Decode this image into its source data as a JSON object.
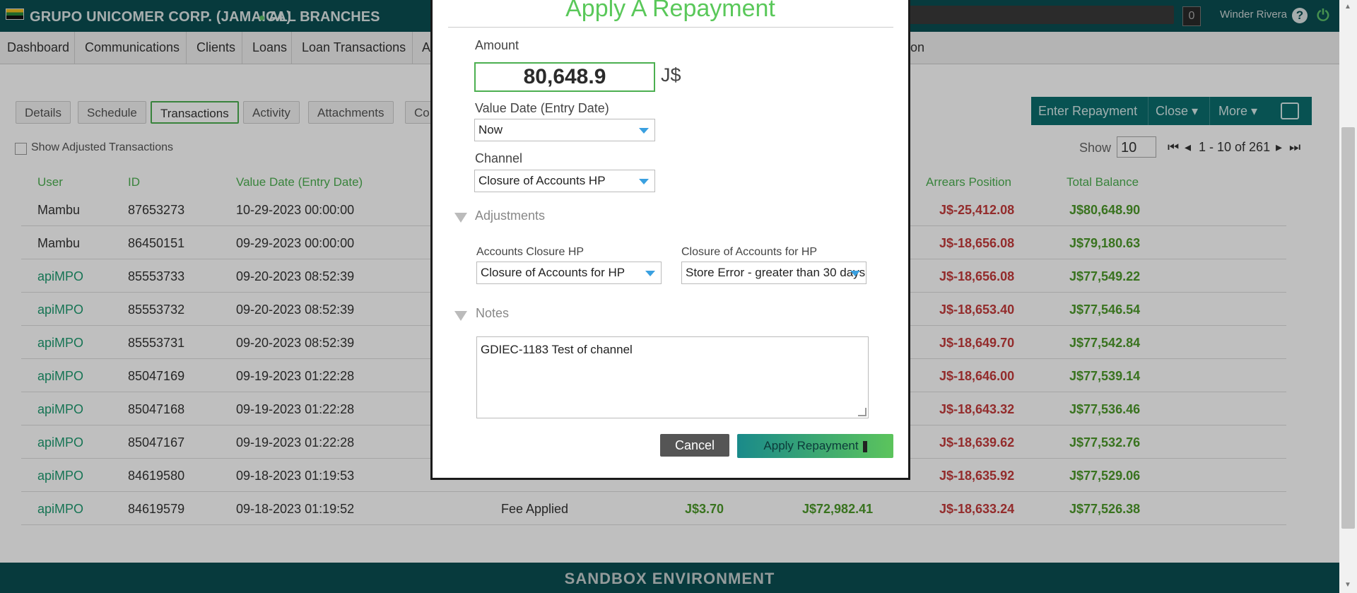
{
  "header": {
    "org_name": "GRUPO UNICOMER CORP. (JAMAICA)",
    "branch": "ALL BRANCHES",
    "notification_count": "0",
    "user_name": "Winder Rivera"
  },
  "nav": {
    "items": [
      "Dashboard",
      "Communications",
      "Clients",
      "Loans",
      "Loan Transactions",
      "A",
      "ion"
    ]
  },
  "tabs": [
    "Details",
    "Schedule",
    "Transactions",
    "Activity",
    "Attachments",
    "Co"
  ],
  "show_adjusted_label": "Show Adjusted Transactions",
  "actions": {
    "enter_repayment": "Enter  Repayment",
    "close": "Close",
    "more": "More"
  },
  "pager": {
    "show_label": "Show",
    "page_size": "10",
    "range": "1 - 10 of 261"
  },
  "table": {
    "headers": [
      "User",
      "ID",
      "Value Date (Entry Date)",
      "Arrears Position",
      "Total Balance"
    ],
    "rows": [
      {
        "user": "Mambu",
        "id": "87653273",
        "date": "10-29-2023 00:00:00",
        "arrears": "J$-25,412.08",
        "balance": "J$80,648.90"
      },
      {
        "user": "Mambu",
        "id": "86450151",
        "date": "09-29-2023 00:00:00",
        "arrears": "J$-18,656.08",
        "balance": "J$79,180.63"
      },
      {
        "user": "apiMPO",
        "id": "85553733",
        "date": "09-20-2023 08:52:39",
        "arrears": "J$-18,656.08",
        "balance": "J$77,549.22"
      },
      {
        "user": "apiMPO",
        "id": "85553732",
        "date": "09-20-2023 08:52:39",
        "arrears": "J$-18,653.40",
        "balance": "J$77,546.54"
      },
      {
        "user": "apiMPO",
        "id": "85553731",
        "date": "09-20-2023 08:52:39",
        "arrears": "J$-18,649.70",
        "balance": "J$77,542.84"
      },
      {
        "user": "apiMPO",
        "id": "85047169",
        "date": "09-19-2023 01:22:28",
        "arrears": "J$-18,646.00",
        "balance": "J$77,539.14"
      },
      {
        "user": "apiMPO",
        "id": "85047168",
        "date": "09-19-2023 01:22:28",
        "arrears": "J$-18,643.32",
        "balance": "J$77,536.46"
      },
      {
        "user": "apiMPO",
        "id": "85047167",
        "date": "09-19-2023 01:22:28",
        "arrears": "J$-18,639.62",
        "balance": "J$77,532.76"
      },
      {
        "user": "apiMPO",
        "id": "84619580",
        "date": "09-18-2023 01:19:53",
        "arrears": "J$-18,635.92",
        "balance": "J$77,529.06"
      },
      {
        "user": "apiMPO",
        "id": "84619579",
        "date": "09-18-2023 01:19:52",
        "type": "Fee Applied",
        "amount": "J$3.70",
        "principal": "J$72,982.41",
        "arrears": "J$-18,633.24",
        "balance": "J$77,526.38"
      }
    ]
  },
  "footer": "SANDBOX ENVIRONMENT",
  "modal": {
    "title": "Apply A Repayment",
    "amount_label": "Amount",
    "amount_value": "80,648.9",
    "currency": "J$",
    "value_date_label": "Value Date (Entry Date)",
    "value_date": "Now",
    "channel_label": "Channel",
    "channel": "Closure of Accounts HP",
    "adjustments_label": "Adjustments",
    "accounts_closure_label": "Accounts Closure HP",
    "accounts_closure_value": "Closure of Accounts for HP",
    "closure_reason_label": "Closure of Accounts for HP",
    "closure_reason_value": "Store Error - greater than 30 days",
    "notes_label": "Notes",
    "notes_value": "GDIEC-1183 Test of channel",
    "cancel": "Cancel",
    "apply": "Apply Repayment"
  }
}
